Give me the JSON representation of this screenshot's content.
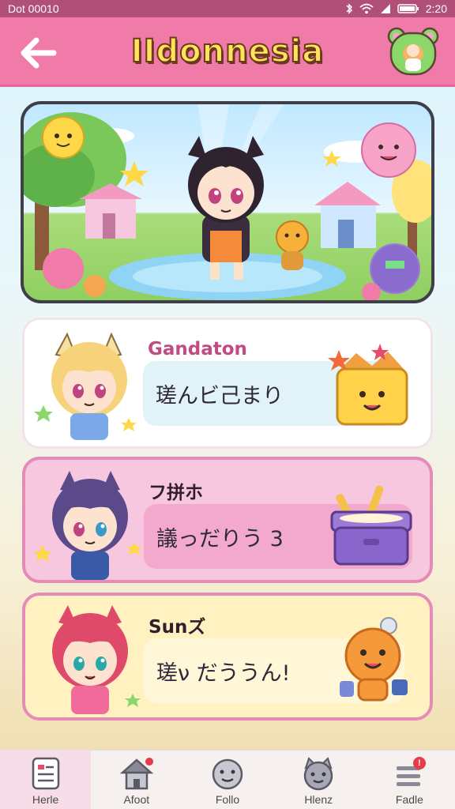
{
  "status_bar": {
    "left_text": "Dot 00010",
    "time": "2:20"
  },
  "header": {
    "title": "IIdonnesia"
  },
  "cards": [
    {
      "name": "Gandaton",
      "phrase": "瑳んビ己まり",
      "accent": "#c24b84"
    },
    {
      "name": "フ拼ホ",
      "phrase": "議っだりう 3",
      "accent": "#2e1f2a"
    },
    {
      "name": "Sunズ",
      "phrase": "瑳ν だううん!",
      "accent": "#2e1f2a"
    }
  ],
  "nav": {
    "items": [
      {
        "label": "Herle",
        "icon": "document-icon"
      },
      {
        "label": "Afoot",
        "icon": "house-icon"
      },
      {
        "label": "Follo",
        "icon": "face-icon"
      },
      {
        "label": "Hlenz",
        "icon": "cat-face-icon"
      },
      {
        "label": "Fadle",
        "icon": "menu-icon",
        "badge": "!"
      }
    ]
  },
  "colors": {
    "header_bg": "#f07aa8",
    "title_yellow": "#ffe35a",
    "card_pink": "#f7c6df",
    "card_yellow": "#fff2c0",
    "nav_active": "#f6dde8"
  }
}
